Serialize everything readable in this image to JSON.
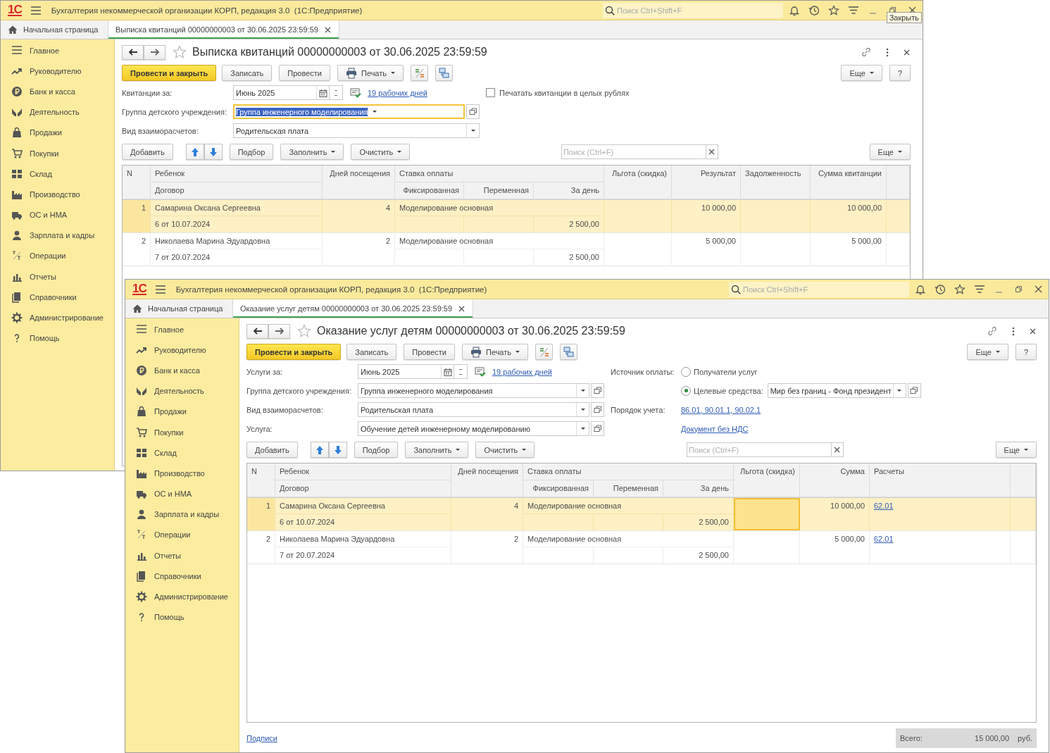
{
  "windows": [
    {
      "logo": "1С",
      "title": "Бухгалтерия некоммерческой организации КОРП, редакция 3.0  (1С:Предприятие)",
      "search": {
        "placeholder": "Поиск Ctrl+Shift+F"
      },
      "tooltip": "Закрыть",
      "tabs": [
        {
          "kind": "home",
          "label": "Начальная страница",
          "selected": false
        },
        {
          "kind": "document",
          "label": "Выписка квитанций 00000000003 от 30.06.2025 23:59:59",
          "selected": true
        }
      ],
      "sidebar": {
        "items": [
          {
            "label": "Главное"
          },
          {
            "label": "Руководителю"
          },
          {
            "label": "Банк и касса"
          },
          {
            "label": "Деятельность"
          },
          {
            "label": "Продажи"
          },
          {
            "label": "Покупки"
          },
          {
            "label": "Склад"
          },
          {
            "label": "Производство"
          },
          {
            "label": "ОС и НМА"
          },
          {
            "label": "Зарплата и кадры"
          },
          {
            "label": "Операции"
          },
          {
            "label": "Отчеты"
          },
          {
            "label": "Справочники"
          },
          {
            "label": "Администрирование"
          },
          {
            "label": "Помощь"
          }
        ]
      },
      "document": {
        "title": "Выписка квитанций 00000000003 от 30.06.2025 23:59:59",
        "toolbar": [
          {
            "kind": "primary",
            "label": "Провести и закрыть"
          },
          {
            "kind": "plain",
            "label": "Записать"
          },
          {
            "kind": "plain",
            "label": "Провести"
          },
          {
            "kind": "print",
            "label": "Печать"
          },
          {
            "kind": "ledger"
          },
          {
            "kind": "structure"
          },
          {
            "kind": "more",
            "label": "Еще"
          },
          {
            "kind": "help",
            "label": "?"
          }
        ],
        "form": {
          "left": [
            {
              "kind": "period",
              "label": "Квитанции за:",
              "value": "Июнь 2025",
              "link": "19 рабочих дней"
            },
            {
              "kind": "select",
              "label": "Группа детского учреждения:",
              "value": "Группа инженерного моделирования",
              "focused": true,
              "open_button": true
            },
            {
              "kind": "select",
              "label": "Вид взаиморасчетов:",
              "value": "Родительская плата",
              "focused": false,
              "open_button": false
            }
          ],
          "right": [
            {
              "kind": "checkbox",
              "label": "Печатать квитанции в целых рублях",
              "checked": false
            }
          ]
        },
        "table_toolbar": [
          {
            "kind": "plain",
            "label": "Добавить"
          },
          {
            "kind": "move"
          },
          {
            "kind": "plain",
            "label": "Подбор"
          },
          {
            "kind": "menu",
            "label": "Заполнить"
          },
          {
            "kind": "menu",
            "label": "Очистить"
          },
          {
            "kind": "search",
            "placeholder": "Поиск (Ctrl+F)"
          },
          {
            "kind": "more",
            "label": "Еще"
          }
        ],
        "table": {
          "header": {
            "n": "N",
            "child": "Ребенок",
            "contract": "Договор",
            "days": "Дней посещения",
            "rate": "Ставка оплаты",
            "fixed": "Фиксированная",
            "variable": "Переменная",
            "per_day": "За день"
          },
          "columns": [
            {
              "label": "Льгота (скидка)",
              "kind": "number"
            },
            {
              "label": "Результат",
              "kind": "number"
            },
            {
              "label": "Задолженность",
              "kind": "text"
            },
            {
              "label": "Сумма квитанции",
              "kind": "number"
            }
          ],
          "rows": [
            {
              "n": "1",
              "child": "Самарина Оксана Сергеевна",
              "contract": "6 от 10.07.2024",
              "days": "4",
              "rate": "Моделирование основная",
              "per_day": "2 500,00",
              "selected": true,
              "cells": [
                {},
                {
                  "value": "10 000,00"
                },
                {},
                {
                  "value": "10 000,00"
                }
              ]
            },
            {
              "n": "2",
              "child": "Николаева Марина Эдуардовна",
              "contract": "7 от 20.07.2024",
              "days": "2",
              "rate": "Моделирование основная",
              "per_day": "2 500,00",
              "selected": false,
              "cells": [
                {},
                {
                  "value": "5 000,00"
                },
                {},
                {
                  "value": "5 000,00"
                }
              ]
            }
          ]
        }
      }
    },
    {
      "logo": "1С",
      "title": "Бухгалтерия некоммерческой организации КОРП, редакция 3.0  (1С:Предприятие)",
      "search": {
        "placeholder": "Поиск Ctrl+Shift+F"
      },
      "tabs": [
        {
          "kind": "home",
          "label": "Начальная страница",
          "selected": false
        },
        {
          "kind": "document",
          "label": "Оказание услуг детям 00000000003 от 30.06.2025 23:59:59",
          "selected": true
        }
      ],
      "sidebar": {
        "items": [
          {
            "label": "Главное"
          },
          {
            "label": "Руководителю"
          },
          {
            "label": "Банк и касса"
          },
          {
            "label": "Деятельность"
          },
          {
            "label": "Продажи"
          },
          {
            "label": "Покупки"
          },
          {
            "label": "Склад"
          },
          {
            "label": "Производство"
          },
          {
            "label": "ОС и НМА"
          },
          {
            "label": "Зарплата и кадры"
          },
          {
            "label": "Операции"
          },
          {
            "label": "Отчеты"
          },
          {
            "label": "Справочники"
          },
          {
            "label": "Администрирование"
          },
          {
            "label": "Помощь"
          }
        ]
      },
      "document": {
        "title": "Оказание услуг детям 00000000003 от 30.06.2025 23:59:59",
        "toolbar": [
          {
            "kind": "primary",
            "label": "Провести и закрыть"
          },
          {
            "kind": "plain",
            "label": "Записать"
          },
          {
            "kind": "plain",
            "label": "Провести"
          },
          {
            "kind": "print",
            "label": "Печать"
          },
          {
            "kind": "ledger"
          },
          {
            "kind": "structure"
          },
          {
            "kind": "more",
            "label": "Еще"
          },
          {
            "kind": "help",
            "label": "?"
          }
        ],
        "form": {
          "left": [
            {
              "kind": "period",
              "label": "Услуги за:",
              "value": "Июнь 2025",
              "link": "19 рабочих дней"
            },
            {
              "kind": "select",
              "label": "Группа детского учреждения:",
              "value": "Группа инженерного моделирования",
              "focused": false,
              "open_button": true
            },
            {
              "kind": "select",
              "label": "Вид взаиморасчетов:",
              "value": "Родительская плата",
              "focused": false,
              "open_button": true
            },
            {
              "kind": "select",
              "label": "Услуга:",
              "value": "Обучение детей инженерному моделированию",
              "focused": false,
              "open_button": true
            }
          ],
          "right": [
            {
              "kind": "radio",
              "caption": "Источник оплаты:",
              "label": "Получатели услуг",
              "selected": false
            },
            {
              "kind": "radio",
              "label": "Целевые средства:",
              "selected": true,
              "value": "Мир без границ - Фонд президент"
            },
            {
              "kind": "link",
              "caption": "Порядок учета:",
              "label": "86.01, 90.01.1, 90.02.1"
            },
            {
              "kind": "link",
              "label": "Документ без НДС"
            }
          ]
        },
        "table_toolbar": [
          {
            "kind": "plain",
            "label": "Добавить"
          },
          {
            "kind": "move"
          },
          {
            "kind": "plain",
            "label": "Подбор"
          },
          {
            "kind": "menu",
            "label": "Заполнить"
          },
          {
            "kind": "menu",
            "label": "Очистить"
          },
          {
            "kind": "search",
            "placeholder": "Поиск (Ctrl+F)"
          },
          {
            "kind": "more",
            "label": "Еще"
          }
        ],
        "table": {
          "header": {
            "n": "N",
            "child": "Ребенок",
            "contract": "Договор",
            "days": "Дней посещения",
            "rate": "Ставка оплаты",
            "fixed": "Фиксированная",
            "variable": "Переменная",
            "per_day": "За день"
          },
          "columns": [
            {
              "label": "Льгота (скидка)",
              "kind": "number"
            },
            {
              "label": "Сумма",
              "kind": "number"
            },
            {
              "label": "Расчеты",
              "kind": "link"
            }
          ],
          "rows": [
            {
              "n": "1",
              "child": "Самарина Оксана Сергеевна",
              "contract": "6 от 10.07.2024",
              "days": "4",
              "rate": "Моделирование основная",
              "per_day": "2 500,00",
              "selected": true,
              "cells": [
                {
                  "focused": true
                },
                {
                  "value": "10 000,00",
                  "focused": false
                },
                {
                  "value": "62.01",
                  "focused": false
                }
              ]
            },
            {
              "n": "2",
              "child": "Николаева Марина Эдуардовна",
              "contract": "7 от 20.07.2024",
              "days": "2",
              "rate": "Моделирование основная",
              "per_day": "2 500,00",
              "selected": false,
              "cells": [
                {
                  "focused": false
                },
                {
                  "value": "5 000,00",
                  "focused": false
                },
                {
                  "value": "62.01",
                  "focused": false
                }
              ]
            }
          ]
        },
        "footer": {
          "link": "Подписи",
          "total_label": "Всего:",
          "total": "15 000,00",
          "currency": "руб."
        }
      }
    }
  ]
}
